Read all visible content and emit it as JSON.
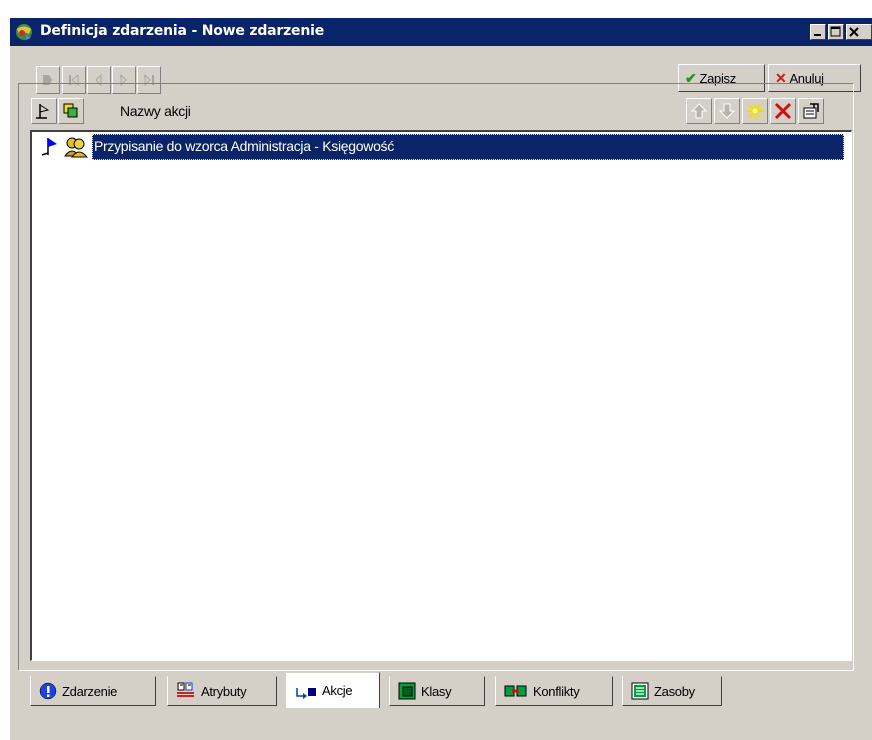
{
  "window": {
    "title": "Definicja zdarzenia - Nowe zdarzenie"
  },
  "toolbar": {
    "save_label": "Zapisz",
    "cancel_label": "Anuluj"
  },
  "list": {
    "column_title": "Nazwy akcji",
    "rows": [
      {
        "label": "Przypisanie do wzorca Administracja - Księgowość",
        "selected": true
      }
    ]
  },
  "tabs": [
    {
      "label": "Zdarzenie",
      "icon": "exclamation-icon",
      "active": false
    },
    {
      "label": "Atrybuty",
      "icon": "attributes-icon",
      "active": false
    },
    {
      "label": "Akcje",
      "icon": "action-arrow-icon",
      "active": true
    },
    {
      "label": "Klasy",
      "icon": "class-box-icon",
      "active": false
    },
    {
      "label": "Konflikty",
      "icon": "conflict-icon",
      "active": false
    },
    {
      "label": "Zasoby",
      "icon": "resources-icon",
      "active": false
    }
  ],
  "colors": {
    "titlebar": "#0a246a",
    "selection": "#0a246a",
    "face": "#d4d0c8"
  }
}
